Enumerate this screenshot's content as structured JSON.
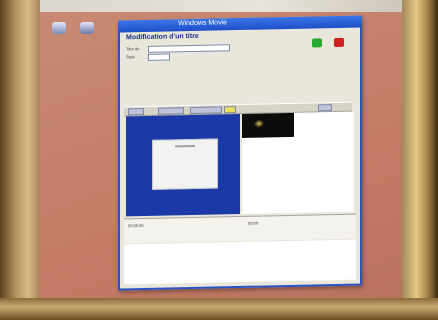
{
  "window": {
    "title": "Windows Movie",
    "heading": "Modification d'un titre"
  },
  "form": {
    "label_1": "Titre du",
    "label_2": "Style"
  },
  "status": {
    "cue_left": "00:00:00",
    "cue_right": "00:00"
  },
  "colors": {
    "window_frame": "#2b52c2",
    "title_bar": "#1f4fc8",
    "slide_background": "#1b3aa8",
    "desktop": "#c8826e"
  },
  "icons": [
    "desktop-icon",
    "desktop-icon",
    "green-arrow-icon",
    "red-close-icon"
  ]
}
